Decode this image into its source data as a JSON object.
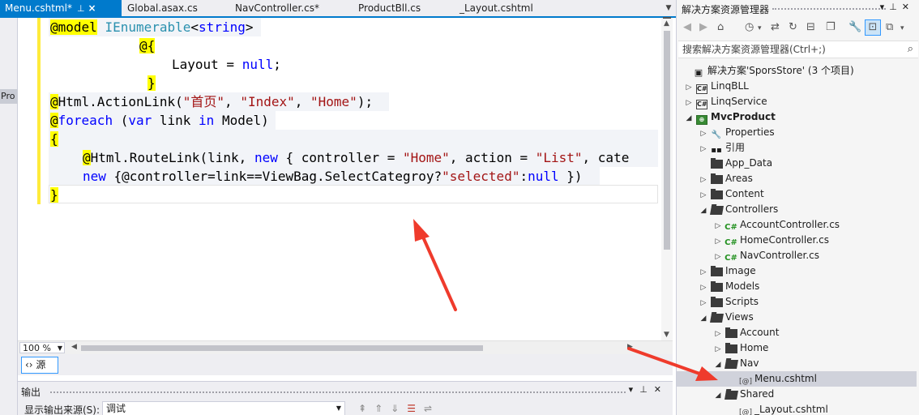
{
  "tabs": [
    {
      "label": "Menu.cshtml*",
      "active": true
    },
    {
      "label": "Global.asax.cs",
      "active": false
    },
    {
      "label": "NavController.cs*",
      "active": false
    },
    {
      "label": "ProductBll.cs",
      "active": false
    },
    {
      "label": "_Layout.cshtml",
      "active": false
    }
  ],
  "left_panel_label": "Pro",
  "code": {
    "line1": [
      "@model",
      " ",
      "IEnumerable",
      "<",
      "string",
      ">"
    ],
    "line2": [
      "@{"
    ],
    "line3": [
      "Layout",
      " = ",
      "null",
      ";"
    ],
    "line4": [
      "}"
    ],
    "line5": [
      "@",
      "Html.ActionLink(",
      "\"首页\"",
      ", ",
      "\"Index\"",
      ", ",
      "\"Home\"",
      ");"
    ],
    "line6": [
      "@",
      "foreach",
      " (",
      "var",
      " link ",
      "in",
      " Model)"
    ],
    "line7": [
      "{"
    ],
    "line8": [
      "@",
      "Html.RouteLink(link, ",
      "new",
      " { controller = ",
      "\"Home\"",
      ", action = ",
      "\"List\"",
      ", cate"
    ],
    "line9": [
      "new",
      " {@controller=link==ViewBag.SelectCategroy?",
      "\"selected\"",
      ":",
      "null",
      " })"
    ],
    "line10": [
      "}"
    ]
  },
  "zoom": "100 %",
  "source_tab": "源",
  "output": {
    "title": "输出",
    "source_label": "显示输出来源(S):",
    "source_value": "调试"
  },
  "solution_explorer": {
    "title": "解决方案资源管理器",
    "search_placeholder": "搜索解决方案资源管理器(Ctrl+;)",
    "tree": [
      {
        "label": "解决方案'SporsStore' (3 个项目)"
      },
      {
        "label": "LinqBLL"
      },
      {
        "label": "LinqService"
      },
      {
        "label": "MvcProduct"
      },
      {
        "label": "Properties"
      },
      {
        "label": "引用"
      },
      {
        "label": "App_Data"
      },
      {
        "label": "Areas"
      },
      {
        "label": "Content"
      },
      {
        "label": "Controllers"
      },
      {
        "label": "AccountController.cs"
      },
      {
        "label": "HomeController.cs"
      },
      {
        "label": "NavController.cs"
      },
      {
        "label": "Image"
      },
      {
        "label": "Models"
      },
      {
        "label": "Scripts"
      },
      {
        "label": "Views"
      },
      {
        "label": "Account"
      },
      {
        "label": "Home"
      },
      {
        "label": "Nav"
      },
      {
        "label": "Menu.cshtml"
      },
      {
        "label": "Shared"
      },
      {
        "label": "_Layout.cshtml"
      }
    ]
  },
  "colors": {
    "accent": "#007acc",
    "highlight": "#ffff00",
    "keyword": "#0000ff",
    "type": "#2b91af",
    "string": "#a31515",
    "annotation": "#ef3b2c"
  }
}
